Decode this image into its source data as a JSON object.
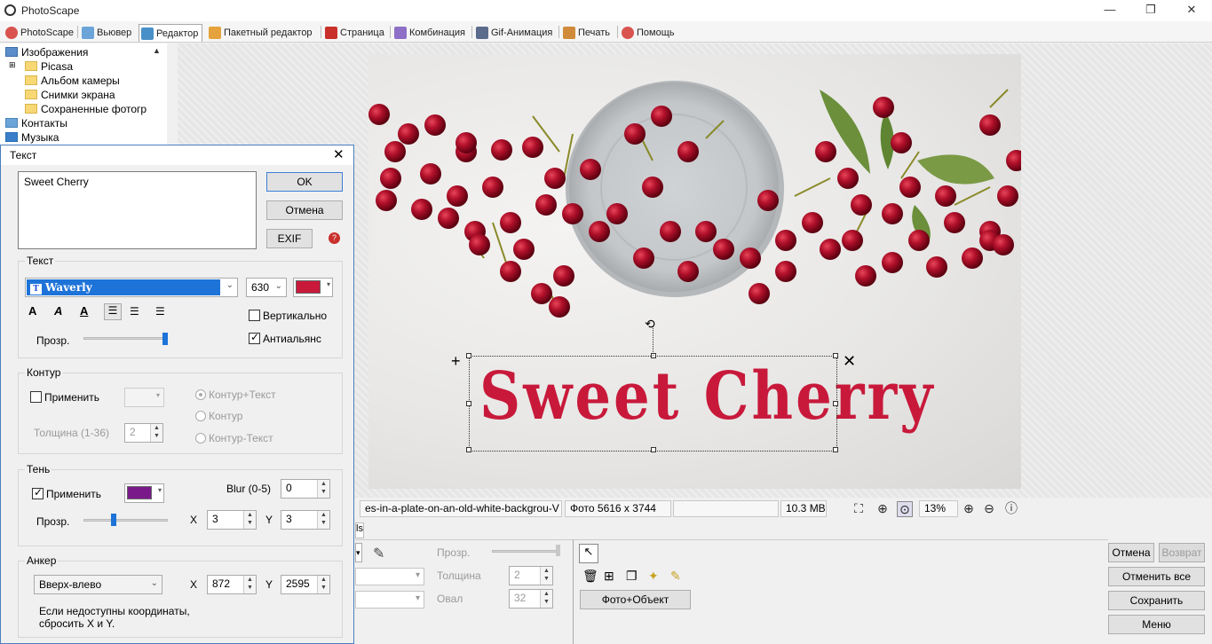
{
  "window": {
    "title": "PhotoScape"
  },
  "tabs": [
    {
      "label": "PhotoScape",
      "color": "#d9534f"
    },
    {
      "label": "Вьювер",
      "color": "#6aa4d8"
    },
    {
      "label": "Редактор",
      "color": "#4a90c8"
    },
    {
      "label": "Пакетный редактор",
      "color": "#e6a23c"
    },
    {
      "label": "Страница",
      "color": "#c9302c"
    },
    {
      "label": "Комбинация",
      "color": "#8e6fc7"
    },
    {
      "label": "Gif-Анимация",
      "color": "#5b6b8c"
    },
    {
      "label": "Печать",
      "color": "#d08a3a"
    },
    {
      "label": "Помощь",
      "color": "#d9534f"
    }
  ],
  "tree": {
    "items": [
      "Изображения",
      "Picasa",
      "Альбом камеры",
      "Снимки экрана",
      "Сохраненные фотогр",
      "Контакты",
      "Музыка"
    ]
  },
  "dialog": {
    "title": "Текст",
    "text_value": "Sweet Cherry",
    "ok": "OK",
    "cancel": "Отмена",
    "exif": "EXIF",
    "text_group": {
      "label": "Текст",
      "font": "Waverly",
      "size": "630",
      "color": "#c8193b",
      "vertical": "Вертикально",
      "antialias": "Антиальянс",
      "opacity_label": "Прозр.",
      "opacity": 1.0
    },
    "outline_group": {
      "label": "Контур",
      "apply": "Применить",
      "thickness_label": "Толщина (1-36)",
      "thickness": "2",
      "opt1": "Контур+Текст",
      "opt2": "Контур",
      "opt3": "Контур-Текст"
    },
    "shadow_group": {
      "label": "Тень",
      "apply": "Применить",
      "color": "#7a1a8a",
      "blur_label": "Blur (0-5)",
      "blur": "0",
      "opacity_label": "Прозр.",
      "opacity": 0.35,
      "x_label": "X",
      "x": "3",
      "y_label": "Y",
      "y": "3"
    },
    "anchor_group": {
      "label": "Анкер",
      "value": "Вверх-влево",
      "x_label": "X",
      "x": "872",
      "y_label": "Y",
      "y": "2595",
      "note_line1": "Если недоступны координаты,",
      "note_line2": "сбросить X и Y."
    }
  },
  "canvas": {
    "overlay_text": "Sweet Cherry",
    "text_color": "#c8193b"
  },
  "status": {
    "filename": "es-in-a-plate-on-an-old-white-backgrou-V",
    "dims": "Фото 5616 x 3744",
    "size": "10.3 MB",
    "zoom": "13%"
  },
  "bottom": {
    "tab_fragment": "ls",
    "opacity_label": "Прозр.",
    "thickness_label": "Толщина",
    "thickness": "2",
    "oval_label": "Овал",
    "oval": "32",
    "photo_object": "Фото+Объект",
    "cancel": "Отмена",
    "redo": "Возврат",
    "cancel_all": "Отменить все",
    "save": "Сохранить",
    "menu": "Меню"
  }
}
